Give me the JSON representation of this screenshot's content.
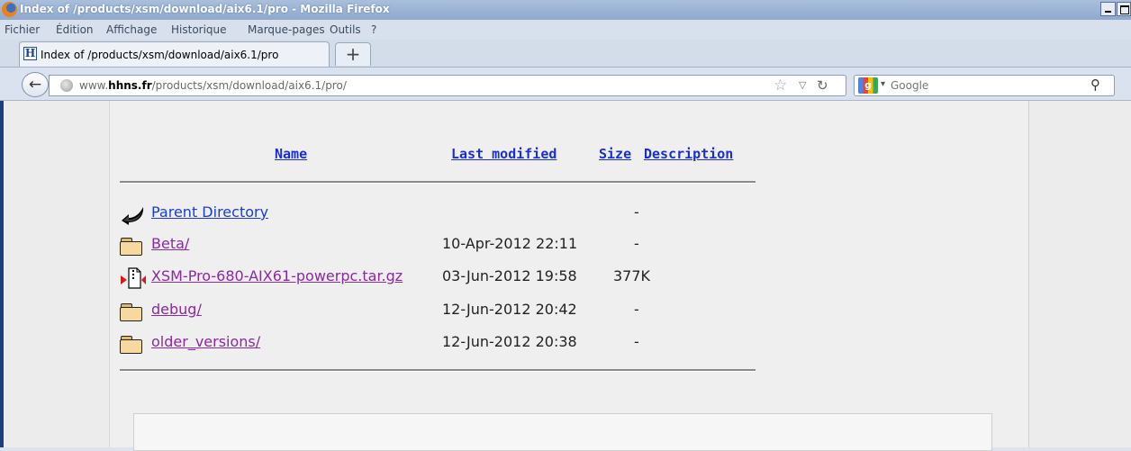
{
  "window": {
    "title": "Index of /products/xsm/download/aix6.1/pro - Mozilla Firefox"
  },
  "menu": [
    "Fichier",
    "Édition",
    "Affichage",
    "Historique",
    "Marque-pages",
    "Outils",
    "?"
  ],
  "tab": {
    "favicon": "H",
    "label": "Index of /products/xsm/download/aix6.1/pro",
    "new_tab": "+"
  },
  "nav": {
    "url_prefix": "www.",
    "url_domain": "hhns.fr",
    "url_path": "/products/xsm/download/aix6.1/pro/",
    "search_placeholder": "Google"
  },
  "listing": {
    "headers": {
      "name": "Name",
      "last_modified": "Last modified",
      "size": "Size",
      "description": "Description"
    },
    "rows": [
      {
        "icon": "back-arrow-icon",
        "name": "Parent Directory",
        "date": "",
        "size": "-",
        "visited": false
      },
      {
        "icon": "folder-icon",
        "name": "Beta/",
        "date": "10-Apr-2012 22:11",
        "size": "-",
        "visited": true
      },
      {
        "icon": "compressed-file-icon",
        "name": "XSM-Pro-680-AIX61-powerpc.tar.gz",
        "date": "03-Jun-2012 19:58",
        "size": "377K",
        "visited": true
      },
      {
        "icon": "folder-icon",
        "name": "debug/",
        "date": "12-Jun-2012 20:42",
        "size": "-",
        "visited": true
      },
      {
        "icon": "folder-icon",
        "name": "older_versions/",
        "date": "12-Jun-2012 20:38",
        "size": "-",
        "visited": true
      }
    ]
  },
  "colors": {
    "link": "#1a3ed4",
    "visited": "#8a2aa0",
    "header_link": "#1a2fd0"
  }
}
